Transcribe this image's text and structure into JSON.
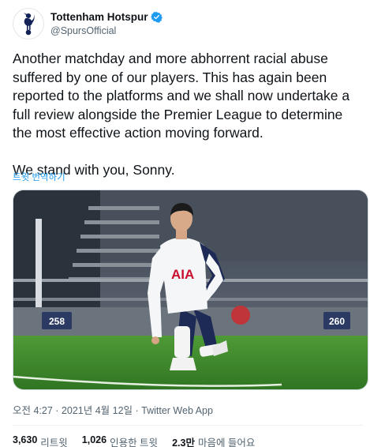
{
  "account": {
    "display_name": "Tottenham Hotspur",
    "handle": "@SpursOfficial",
    "verified": true,
    "avatar_icon": "cockerel-logo-icon"
  },
  "tweet": {
    "paragraph1": "Another matchday and more abhorrent racial abuse suffered by one of our players. This has again been reported to the platforms and we shall now undertake a full review alongside the Premier League to determine the most effective action moving forward.",
    "paragraph2": "We stand with you, Sonny.",
    "translate_label": "트윗 번역하기"
  },
  "media": {
    "sponsor_text": "AIA",
    "board_numbers": [
      "258",
      "260"
    ]
  },
  "meta": {
    "timestamp": "오전 4:27 · 2021년 4월 12일",
    "separator": " · ",
    "source": "Twitter Web App"
  },
  "stats": {
    "retweets_count": "3,630",
    "retweets_label": "리트윗",
    "quotes_count": "1,026",
    "quotes_label": "인용한 트윗",
    "likes_count": "2.3만",
    "likes_label": "마음에 들어요"
  },
  "colors": {
    "accent": "#1d9bf0",
    "text_primary": "#0f1419",
    "text_secondary": "#536471",
    "pitch_green": "#3f8a2c"
  }
}
